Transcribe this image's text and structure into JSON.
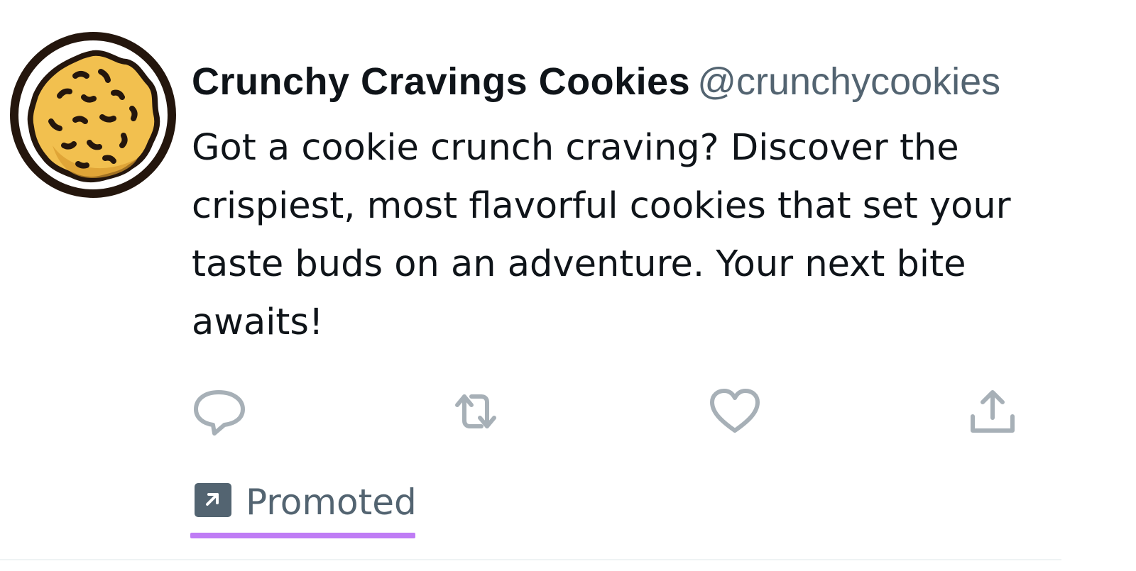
{
  "tweet": {
    "author": {
      "display_name": "Crunchy Cravings Cookies",
      "handle": "@crunchycookies",
      "avatar_icon": "cookie-icon"
    },
    "text": "Got a cookie crunch craving? Discover the crispiest, most flavorful cookies that set your taste buds on an adventure. Your next bite awaits!",
    "actions": {
      "reply_icon": "reply-icon",
      "retweet_icon": "retweet-icon",
      "like_icon": "heart-icon",
      "share_icon": "share-icon"
    },
    "promoted": {
      "label": "Promoted",
      "icon": "promoted-arrow-icon"
    }
  },
  "colors": {
    "text_primary": "#0f1419",
    "text_secondary": "#536471",
    "action_icon": "#a7b0b7",
    "underline": "#bf7cf5",
    "cookie_fill": "#f3c35a",
    "cookie_outline": "#2a1a10"
  }
}
